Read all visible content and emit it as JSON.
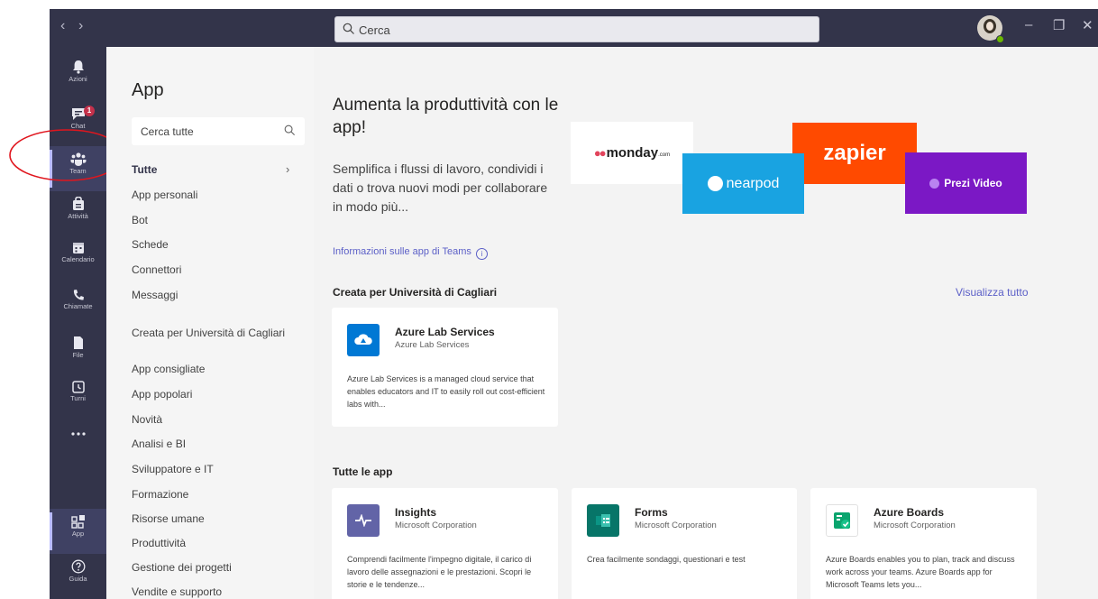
{
  "titlebar": {
    "back_icon": "chevron-left-icon",
    "forward_icon": "chevron-right-icon",
    "search_placeholder": "Cerca",
    "minimize_glyph": "–",
    "maximize_glyph": "❐",
    "close_glyph": "✕"
  },
  "rail": {
    "items": [
      {
        "label": "Azioni",
        "icon": "bell-icon"
      },
      {
        "label": "Chat",
        "icon": "chat-icon",
        "badge": "1"
      },
      {
        "label": "Team",
        "icon": "teams-icon"
      },
      {
        "label": "Attività",
        "icon": "assignments-icon"
      },
      {
        "label": "Calendario",
        "icon": "calendar-icon"
      },
      {
        "label": "Chiamate",
        "icon": "phone-icon"
      },
      {
        "label": "File",
        "icon": "file-icon"
      },
      {
        "label": "Turni",
        "icon": "shifts-icon"
      },
      {
        "label": "...",
        "icon": "more-icon"
      },
      {
        "label": "App",
        "icon": "apps-icon"
      },
      {
        "label": "Guida",
        "icon": "help-icon"
      }
    ]
  },
  "panel": {
    "title": "App",
    "search_placeholder": "Cerca tutte",
    "categories": [
      "Tutte",
      "App personali",
      "Bot",
      "Schede",
      "Connettori",
      "Messaggi",
      "Creata per Università di Cagliari",
      "App consigliate",
      "App popolari",
      "Novità",
      "Analisi e BI",
      "Sviluppatore e IT",
      "Formazione",
      "Risorse umane",
      "Produttività",
      "Gestione dei progetti",
      "Vendite e supporto"
    ],
    "chevron": "›"
  },
  "main": {
    "hero_title": "Aumenta la produttività con le app!",
    "hero_subtitle": "Semplifica i flussi di lavoro, condividi i dati o trova nuovi modi per collaborare in modo più...",
    "learn_link": "Informazioni sulle app di Teams",
    "logos": {
      "monday": "monday",
      "monday_suffix": ".com",
      "nearpod": "nearpod",
      "zapier": "zapier",
      "prezi": "Prezi Video"
    },
    "section_org": "Creata per Università di Cagliari",
    "see_all": "Visualizza tutto",
    "org_apps": [
      {
        "name": "Azure Lab Services",
        "publisher": "Azure Lab Services",
        "description": "Azure Lab Services is a managed cloud service that enables educators and IT to easily roll out cost-efficient labs with...",
        "color": "#0078d4"
      }
    ],
    "section_all": "Tutte le app",
    "all_apps": [
      {
        "name": "Insights",
        "publisher": "Microsoft Corporation",
        "description": "Comprendi facilmente l'impegno digitale, il carico di lavoro delle assegnazioni e le prestazioni. Scopri le storie e le tendenze...",
        "color": "#6264a7"
      },
      {
        "name": "Forms",
        "publisher": "Microsoft Corporation",
        "description": "Crea facilmente sondaggi, questionari e test",
        "color": "#077568"
      },
      {
        "name": "Azure Boards",
        "publisher": "Microsoft Corporation",
        "description": "Azure Boards enables you to plan, track and discuss work across your teams. Azure Boards app for Microsoft Teams lets you...",
        "color": "#009ccc"
      }
    ]
  }
}
